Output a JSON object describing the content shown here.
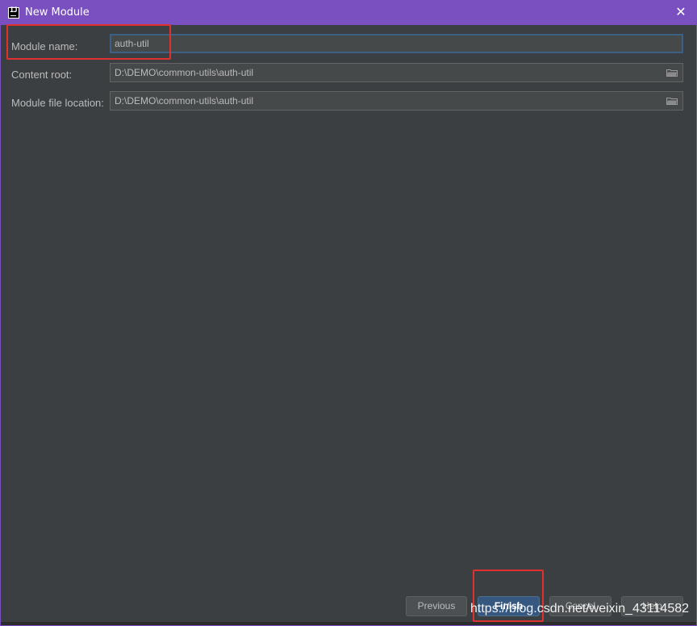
{
  "window": {
    "title": "New Module",
    "accent_color": "#7a4fbf",
    "app_icon": "intellij-icon",
    "app_icon_text": "IJ",
    "close_icon": "close-icon"
  },
  "form": {
    "module_name": {
      "label": "Module name:",
      "value": "auth-util"
    },
    "content_root": {
      "label": "Content root:",
      "value": "D:\\DEMO\\common-utils\\auth-util"
    },
    "module_file_location": {
      "label": "Module file location:",
      "value": "D:\\DEMO\\common-utils\\auth-util"
    }
  },
  "buttons": {
    "previous": "Previous",
    "finish": "Finish",
    "cancel": "Cancel",
    "help": "Help"
  },
  "watermark": "https://blog.csdn.net/weixin_43114582",
  "annotation_color": "#e03030"
}
